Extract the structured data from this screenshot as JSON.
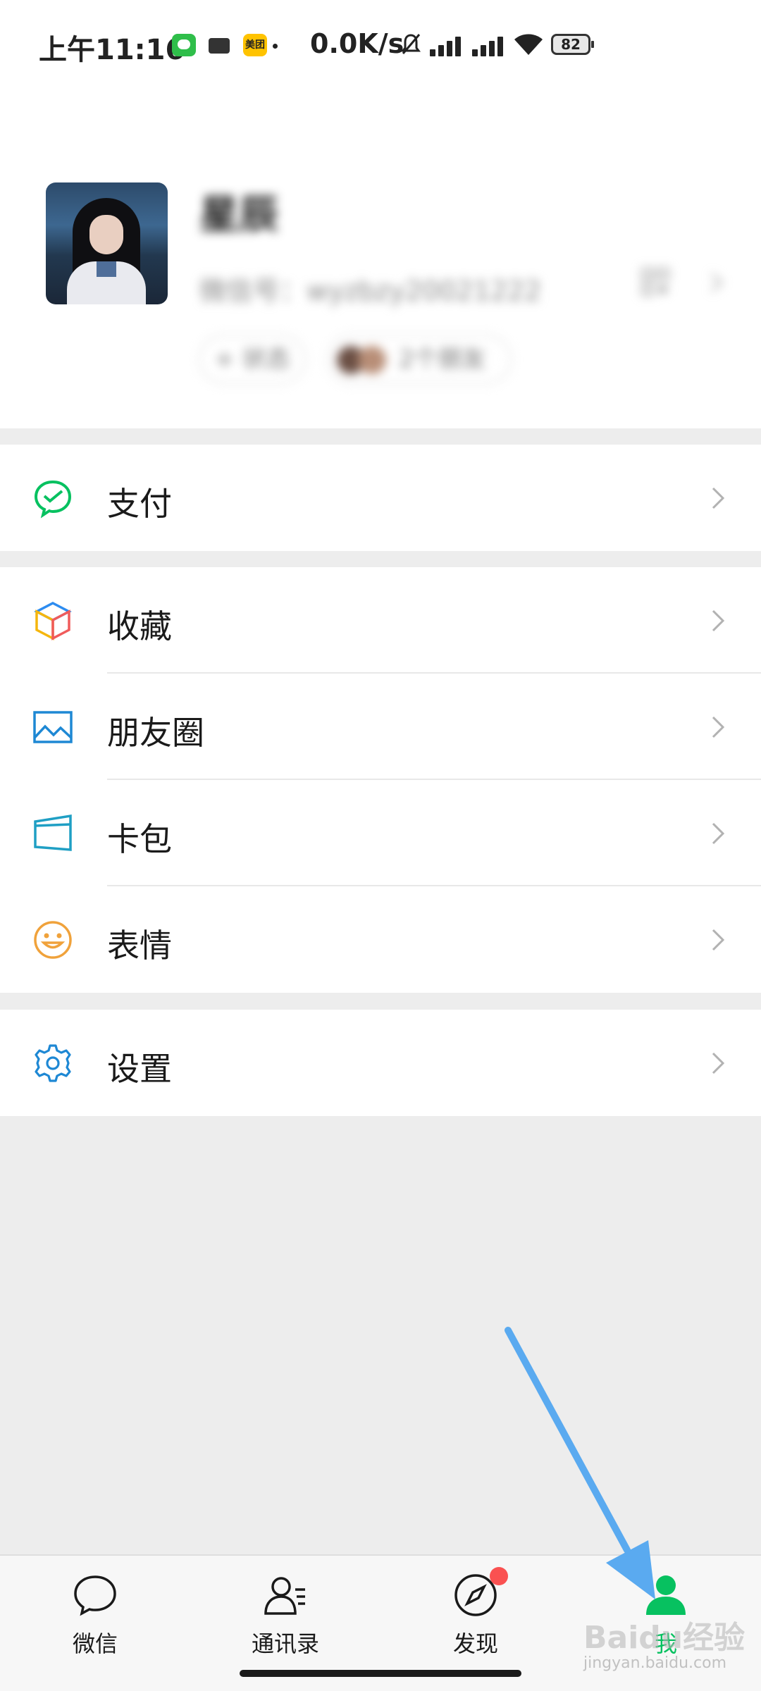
{
  "status_bar": {
    "time": "上午11:16",
    "net_speed": "0.0K/s",
    "battery": "82",
    "apps": [
      "message-app-icon",
      "wallet-app-icon",
      "meituan-app-icon"
    ],
    "meituan_label": "美团"
  },
  "profile": {
    "nickname": "星辰",
    "wechat_id": "微信号：wyzbzy20021222",
    "status_label": "+ 状态",
    "friends_label": "2个朋友"
  },
  "menu": {
    "pay": "支付",
    "favorites": "收藏",
    "moments": "朋友圈",
    "cards": "卡包",
    "stickers": "表情",
    "settings": "设置"
  },
  "tabbar": {
    "chats": "微信",
    "contacts": "通讯录",
    "discover": "发现",
    "me": "我"
  },
  "colors": {
    "accent": "#07c160",
    "badge": "#fa5151",
    "annotation_arrow": "#5aaaf0",
    "page_bg": "#ededed"
  },
  "watermark": {
    "brand": "Baidu经验",
    "url": "jingyan.baidu.com"
  }
}
